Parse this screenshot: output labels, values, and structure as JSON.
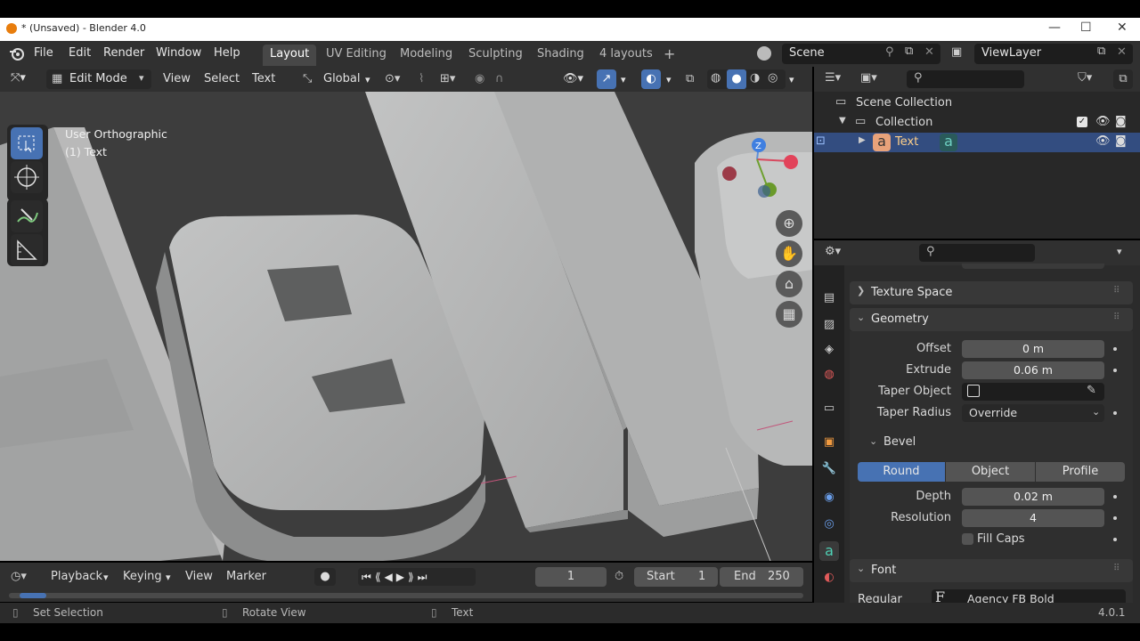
{
  "window": {
    "title": "* (Unsaved) - Blender 4.0",
    "minimize": "—",
    "maximize": "☐",
    "close": "✕"
  },
  "menu": {
    "items": [
      "File",
      "Edit",
      "Render",
      "Window",
      "Help"
    ]
  },
  "workspaces": {
    "tabs": [
      "Layout",
      "UV Editing",
      "Modeling",
      "Sculpting",
      "Shading",
      "4 layouts"
    ],
    "active": "Layout",
    "add": "+"
  },
  "scene": {
    "name": "Scene",
    "view_layer": "ViewLayer"
  },
  "viewport_header": {
    "mode": "Edit Mode",
    "view": "View",
    "select": "Select",
    "text": "Text",
    "orientation": "Global"
  },
  "viewport": {
    "view_name": "User Orthographic",
    "object_name": "(1) Text",
    "axis_z": "Z"
  },
  "timeline": {
    "playback": "Playback",
    "keying": "Keying",
    "view": "View",
    "marker": "Marker",
    "current_frame": "1",
    "start_label": "Start",
    "start": "1",
    "end_label": "End",
    "end": "250"
  },
  "status": {
    "left": "Set Selection",
    "middle": "Rotate View",
    "right": "Text",
    "version": "4.0.1"
  },
  "outliner": {
    "scene_collection": "Scene Collection",
    "collection": "Collection",
    "object": "Text"
  },
  "properties": {
    "texture_space": "Texture Space",
    "geometry": "Geometry",
    "offset_label": "Offset",
    "offset": "0 m",
    "extrude_label": "Extrude",
    "extrude": "0.06 m",
    "taper_object_label": "Taper Object",
    "taper_radius_label": "Taper Radius",
    "taper_radius": "Override",
    "bevel": "Bevel",
    "bevel_modes": [
      "Round",
      "Object",
      "Profile"
    ],
    "bevel_active": "Round",
    "depth_label": "Depth",
    "depth": "0.02 m",
    "resolution_label": "Resolution",
    "resolution": "4",
    "fill_caps": "Fill Caps",
    "font": "Font",
    "regular_label": "Regular",
    "regular_font": "Agency FB Bold"
  },
  "colors": {
    "accent": "#4772b3",
    "bg": "#303030"
  }
}
